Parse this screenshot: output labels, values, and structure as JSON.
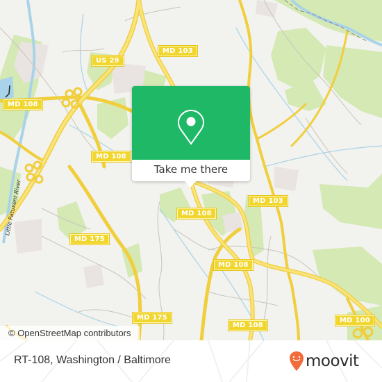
{
  "map": {
    "colors": {
      "background": "#f2f2ee",
      "park": "#d4e9b4",
      "residential": "#e9e4e1",
      "water": "#a9d3e8",
      "road_major": "#f7dd56",
      "road_minor": "#c9c4bd"
    },
    "road_shields": [
      {
        "label": "MD 103",
        "id": "md103-north"
      },
      {
        "label": "US 29",
        "id": "us29"
      },
      {
        "label": "MD 108",
        "id": "md108-west"
      },
      {
        "label": "MD 108",
        "id": "md108-center-west"
      },
      {
        "label": "MD 108",
        "id": "md108-center"
      },
      {
        "label": "MD 103",
        "id": "md103-east"
      },
      {
        "label": "MD 175",
        "id": "md175-west"
      },
      {
        "label": "MD 108",
        "id": "md108-south-center"
      },
      {
        "label": "MD 175",
        "id": "md175-south"
      },
      {
        "label": "MD 108",
        "id": "md108-south"
      },
      {
        "label": "MD 100",
        "id": "md100"
      }
    ],
    "river_label": "Little Patuxent River",
    "attribution": "© OpenStreetMap contributors"
  },
  "popup": {
    "icon": "map-pin-icon",
    "cta_label": "Take me there",
    "accent_color": "#1eb866"
  },
  "footer": {
    "location_title": "RT-108, Washington / Baltimore",
    "brand": "moovit",
    "brand_color": "#f26b3a"
  }
}
